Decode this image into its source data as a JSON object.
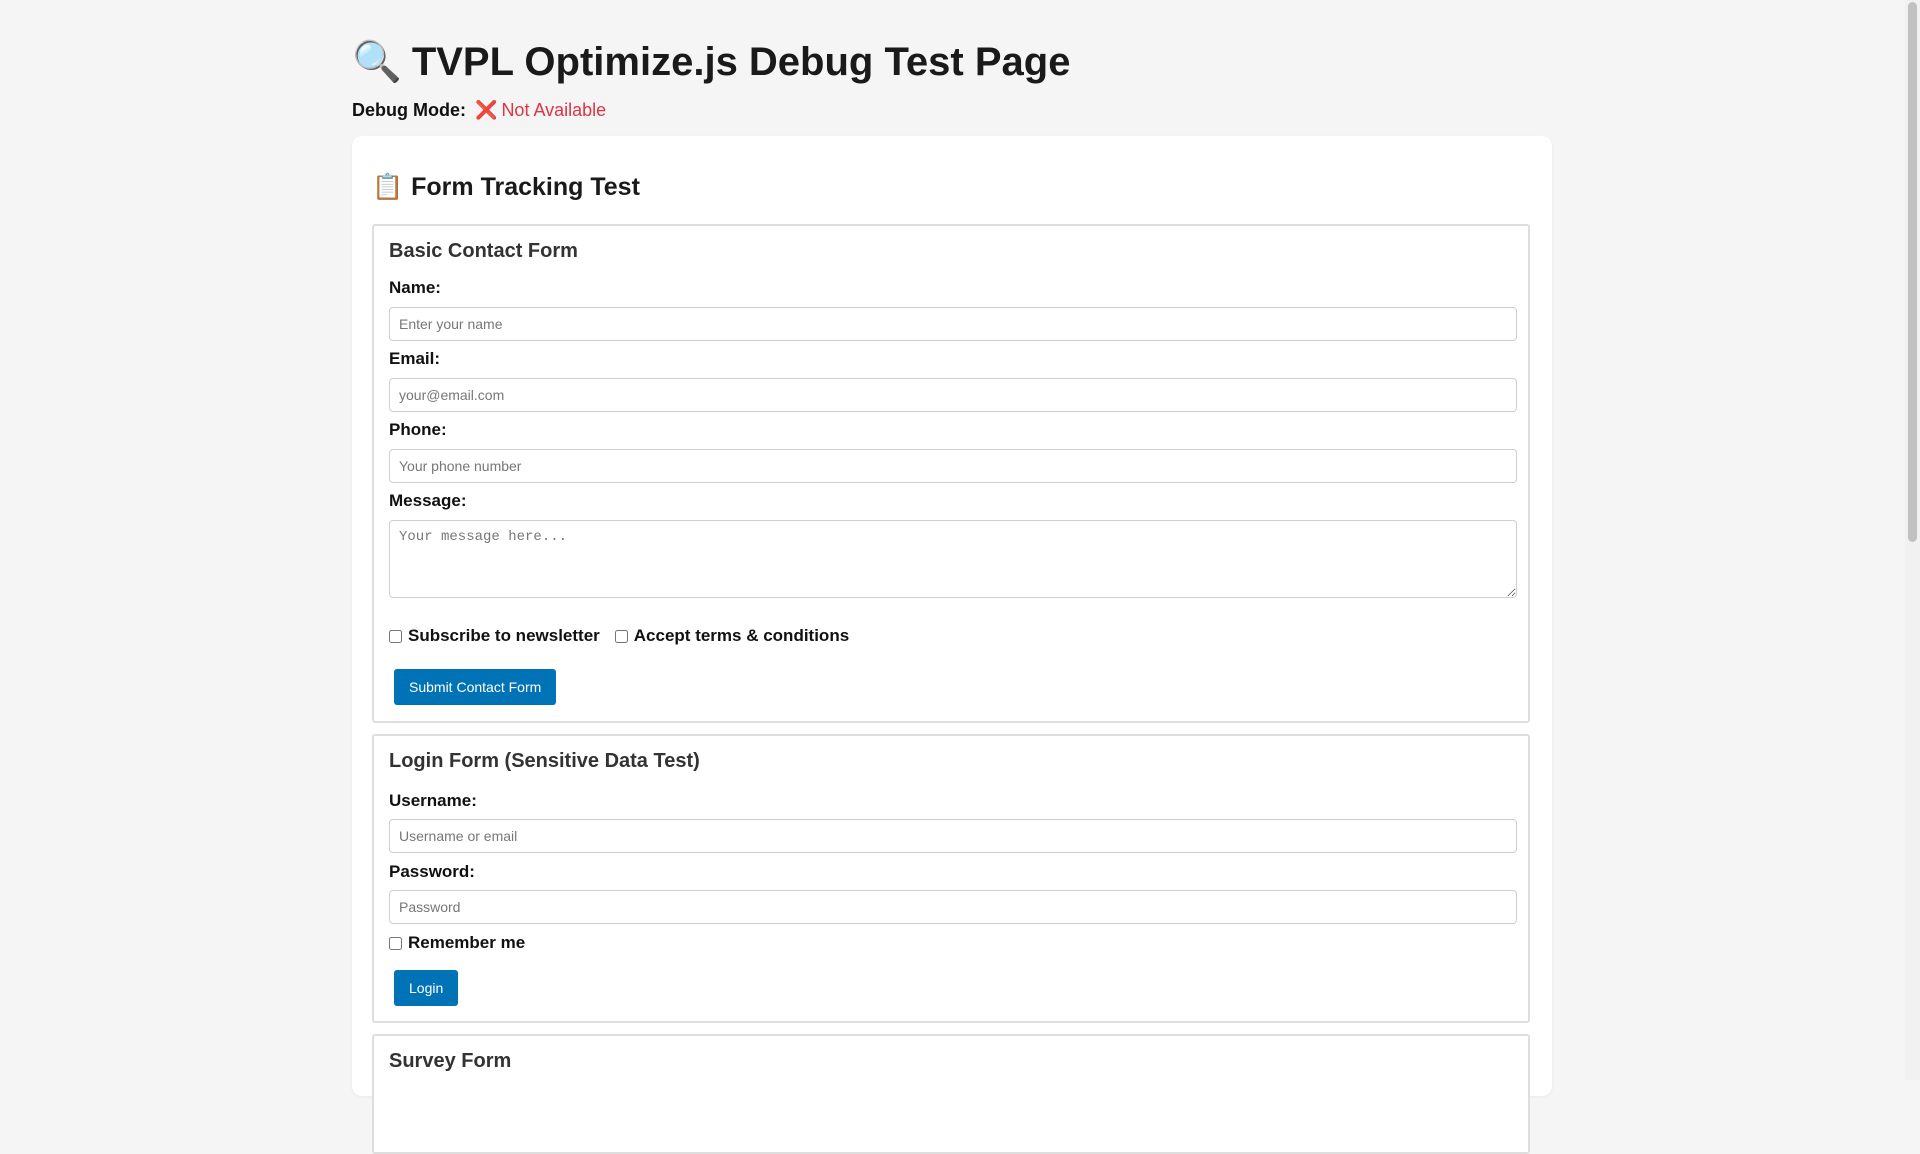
{
  "page": {
    "title": "TVPL Optimize.js Debug Test Page",
    "title_icon": "🔍",
    "title_icon_name": "magnifier-icon",
    "debug_label": "Debug Mode:",
    "debug_icon": "❌",
    "debug_status": "Not Available",
    "debug_status_color": "#dc3545"
  },
  "section": {
    "title": "Form Tracking Test",
    "title_icon": "📋"
  },
  "contact_form": {
    "title": "Basic Contact Form",
    "name_label": "Name:",
    "name_placeholder": "Enter your name",
    "email_label": "Email:",
    "email_placeholder": "your@email.com",
    "phone_label": "Phone:",
    "phone_placeholder": "Your phone number",
    "message_label": "Message:",
    "message_placeholder": "Your message here...",
    "newsletter_label": "Subscribe to newsletter",
    "newsletter_checked": false,
    "terms_label": "Accept terms & conditions",
    "terms_checked": false,
    "submit_label": "Submit Contact Form"
  },
  "login_form": {
    "title": "Login Form (Sensitive Data Test)",
    "username_label": "Username:",
    "username_placeholder": "Username or email",
    "password_label": "Password:",
    "password_placeholder": "Password",
    "remember_label": "Remember me",
    "remember_checked": false,
    "submit_label": "Login"
  },
  "survey_form": {
    "title": "Survey Form"
  },
  "colors": {
    "background": "#f5f5f5",
    "primary_button": "#0073b7",
    "error": "#dc3545"
  }
}
